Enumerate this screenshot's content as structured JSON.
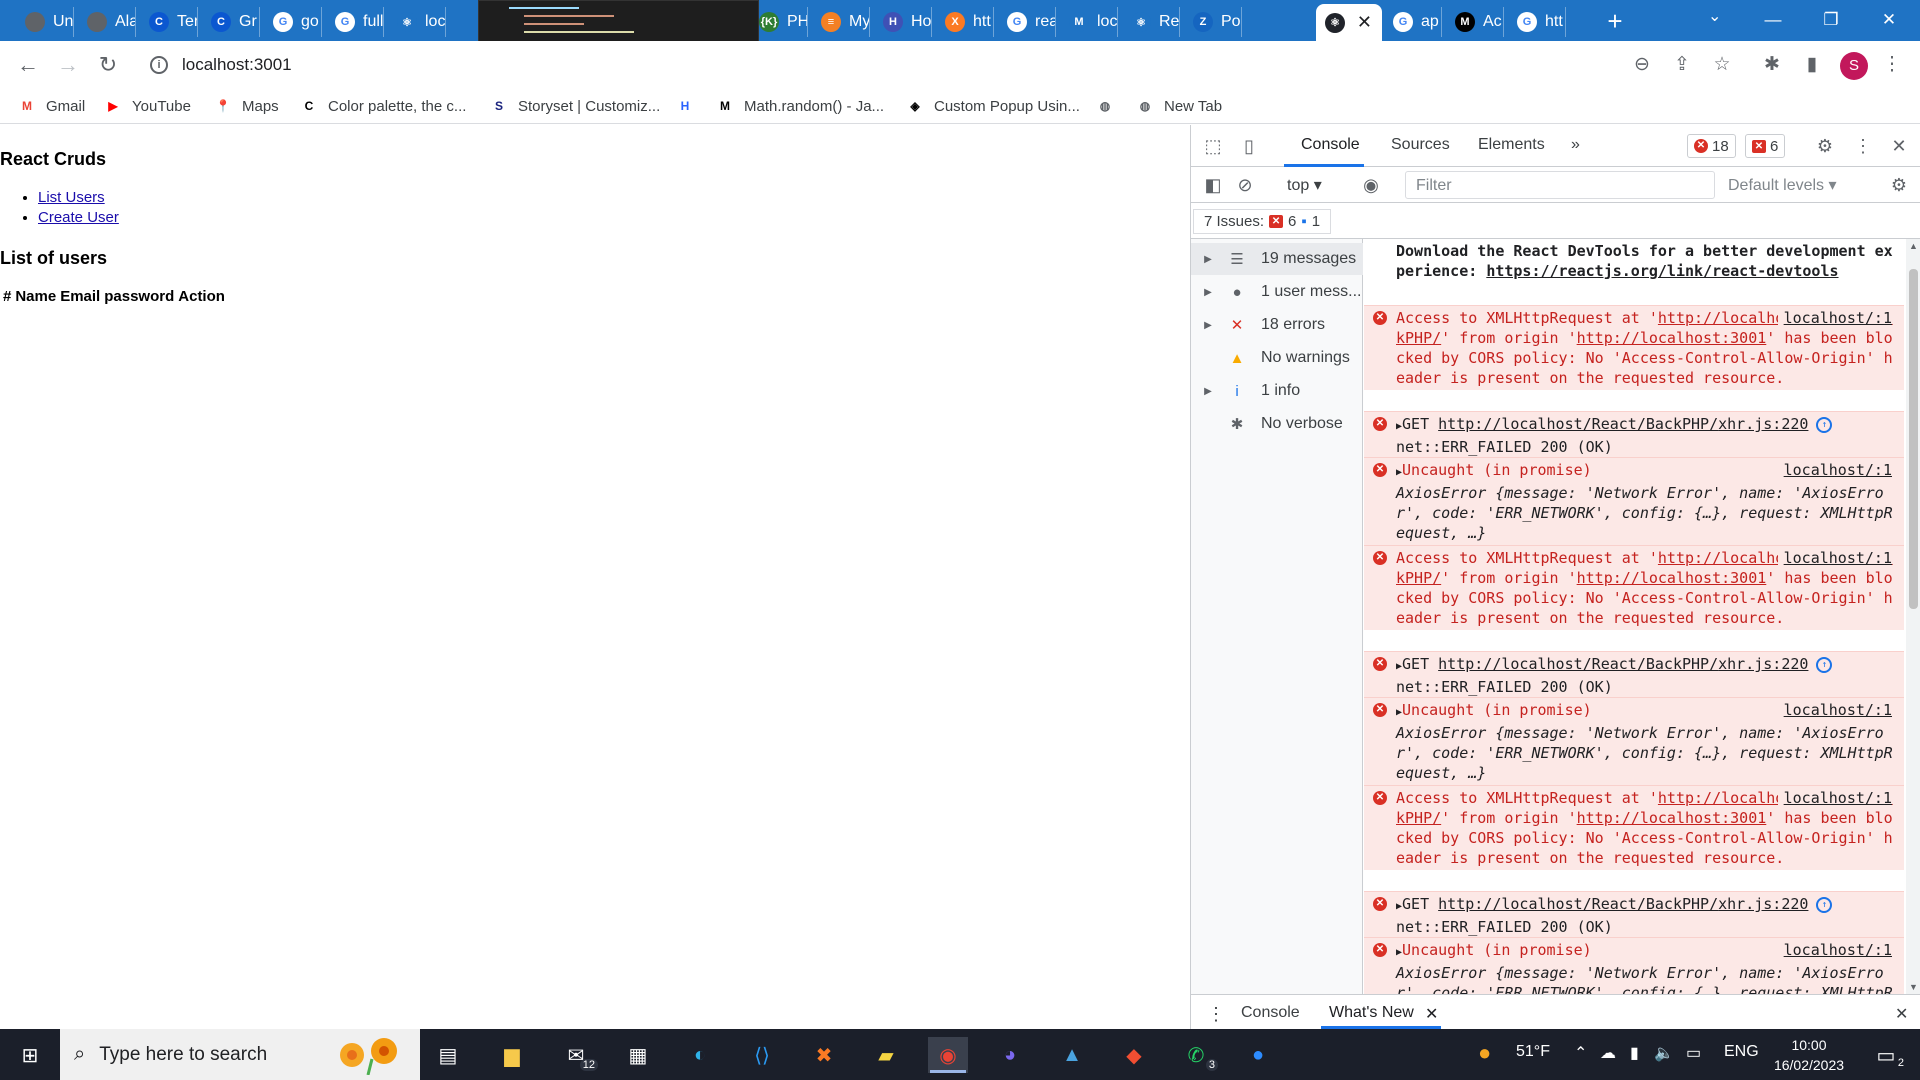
{
  "browser": {
    "tabs": [
      {
        "title": "Un",
        "fav": "chrome-grey",
        "color": "#5f6368",
        "glyph": ""
      },
      {
        "title": "Ala",
        "fav": "chrome-grey",
        "color": "#5f6368",
        "glyph": ""
      },
      {
        "title": "Ter",
        "fav": "c-logo",
        "color": "#0b57d0",
        "glyph": "C"
      },
      {
        "title": "Gr",
        "fav": "c-logo",
        "color": "#0b57d0",
        "glyph": "C"
      },
      {
        "title": "go",
        "fav": "google",
        "color": "#ffffff",
        "glyph": "G"
      },
      {
        "title": "full",
        "fav": "google",
        "color": "#ffffff",
        "glyph": "G"
      },
      {
        "title": "loc",
        "fav": "react",
        "color": "#1f73c4",
        "glyph": "⚛"
      },
      {
        "title": "PH",
        "fav": "code",
        "color": "#2e7d32",
        "glyph": "{K}"
      },
      {
        "title": "My",
        "fav": "stack",
        "color": "#f48024",
        "glyph": "≡"
      },
      {
        "title": "Ho",
        "fav": "hashnode",
        "color": "#3f51b5",
        "glyph": "H"
      },
      {
        "title": "htt",
        "fav": "xampp",
        "color": "#fb7a24",
        "glyph": "X"
      },
      {
        "title": "rea",
        "fav": "google",
        "color": "#ffffff",
        "glyph": "G"
      },
      {
        "title": "loc",
        "fav": "ml",
        "color": "#1f73c4",
        "glyph": "M"
      },
      {
        "title": "Re",
        "fav": "react",
        "color": "#1f73c4",
        "glyph": "⚛"
      },
      {
        "title": "Po",
        "fav": "z-logo",
        "color": "#1565c0",
        "glyph": "Z"
      },
      {
        "title": "",
        "fav": "react",
        "color": "#20232a",
        "glyph": "⚛",
        "active": true
      },
      {
        "title": "ap",
        "fav": "google",
        "color": "#ffffff",
        "glyph": "G"
      },
      {
        "title": "Ac",
        "fav": "medium",
        "color": "#000000",
        "glyph": "M"
      },
      {
        "title": "htt",
        "fav": "google",
        "color": "#ffffff",
        "glyph": "G"
      }
    ],
    "url": "localhost:3001",
    "avatar_letter": "S",
    "bookmarks": [
      {
        "label": "Gmail",
        "icon": "gmail-icon",
        "glyph": "M",
        "color": "#ea4335"
      },
      {
        "label": "YouTube",
        "icon": "youtube-icon",
        "glyph": "▶",
        "color": "#ff0000"
      },
      {
        "label": "Maps",
        "icon": "maps-icon",
        "glyph": "📍",
        "color": "#34a853"
      },
      {
        "label": "Color palette, the c...",
        "icon": "coolors-icon",
        "glyph": "C",
        "color": "#000000"
      },
      {
        "label": "Storyset | Customiz...",
        "icon": "storyset-icon",
        "glyph": "S",
        "color": "#1a237e"
      },
      {
        "label": "",
        "icon": "hashnode-icon",
        "glyph": "H",
        "color": "#2962ff"
      },
      {
        "label": "Math.random() - Ja...",
        "icon": "mdn-icon",
        "glyph": "M",
        "color": "#000000"
      },
      {
        "label": "Custom Popup Usin...",
        "icon": "codepen-icon",
        "glyph": "◈",
        "color": "#000000"
      },
      {
        "label": "",
        "icon": "globe-icon",
        "glyph": "◍",
        "color": "#5f6368"
      },
      {
        "label": "New Tab",
        "icon": "globe-icon",
        "glyph": "◍",
        "color": "#5f6368"
      }
    ]
  },
  "page": {
    "heading": "React Cruds",
    "links": [
      "List Users",
      "Create User"
    ],
    "subheading": "List of users",
    "table_headers": [
      "#",
      "Name",
      "Email",
      "password",
      "Action"
    ]
  },
  "devtools": {
    "tabs": [
      "Console",
      "Sources",
      "Elements"
    ],
    "more": "»",
    "error_count": "18",
    "issue_count": "6",
    "context": "top",
    "filter_placeholder": "Filter",
    "levels": "Default levels",
    "issues_label": "7 Issues:",
    "issues_errors": "6",
    "issues_info": "1",
    "sidebar": [
      {
        "label": "19 messages",
        "icon": "list-icon",
        "arrow": true
      },
      {
        "label": "1 user mess...",
        "icon": "user-icon",
        "arrow": true
      },
      {
        "label": "18 errors",
        "icon": "error-icon",
        "arrow": true
      },
      {
        "label": "No warnings",
        "icon": "warning-icon",
        "arrow": false
      },
      {
        "label": "1 info",
        "icon": "info-icon",
        "arrow": true
      },
      {
        "label": "No verbose",
        "icon": "bug-icon",
        "arrow": false
      }
    ],
    "messages": {
      "download": "Download the React DevTools for a better development experience: ",
      "download_link": "https://reactjs.org/link/react-devtools",
      "cors_a": "Access to XMLHttpRequest at '",
      "cors_url": "http://localhost/React/BackPHP/",
      "cors_b": "' from origin '",
      "cors_origin": "http://localhost:3001",
      "cors_c": "' has been blocked by CORS policy: No 'Access-Control-Allow-Origin' header is present on the requested resource.",
      "cors_src": "localhost/:1",
      "get_a": "GET ",
      "get_url": "http://localhost/React/BackPHP/",
      "get_b": "net::ERR_FAILED 200 (OK)",
      "get_src": "xhr.js:220",
      "unc_a": "Uncaught (in promise)",
      "unc_src": "localhost/:1",
      "unc_b": "AxiosError {message: 'Network Error', name: 'AxiosError', code: 'ERR_NETWORK', config: {…}, request: XMLHttpRequest, …}"
    },
    "drawer_tabs": [
      "Console",
      "What's New"
    ]
  },
  "taskbar": {
    "search_placeholder": "Type here to search",
    "weather": "51°F",
    "language": "ENG",
    "time": "10:00",
    "date": "16/02/2023",
    "mail_badge": "12",
    "whatsapp_badge": "3",
    "notif_badge": "2"
  }
}
